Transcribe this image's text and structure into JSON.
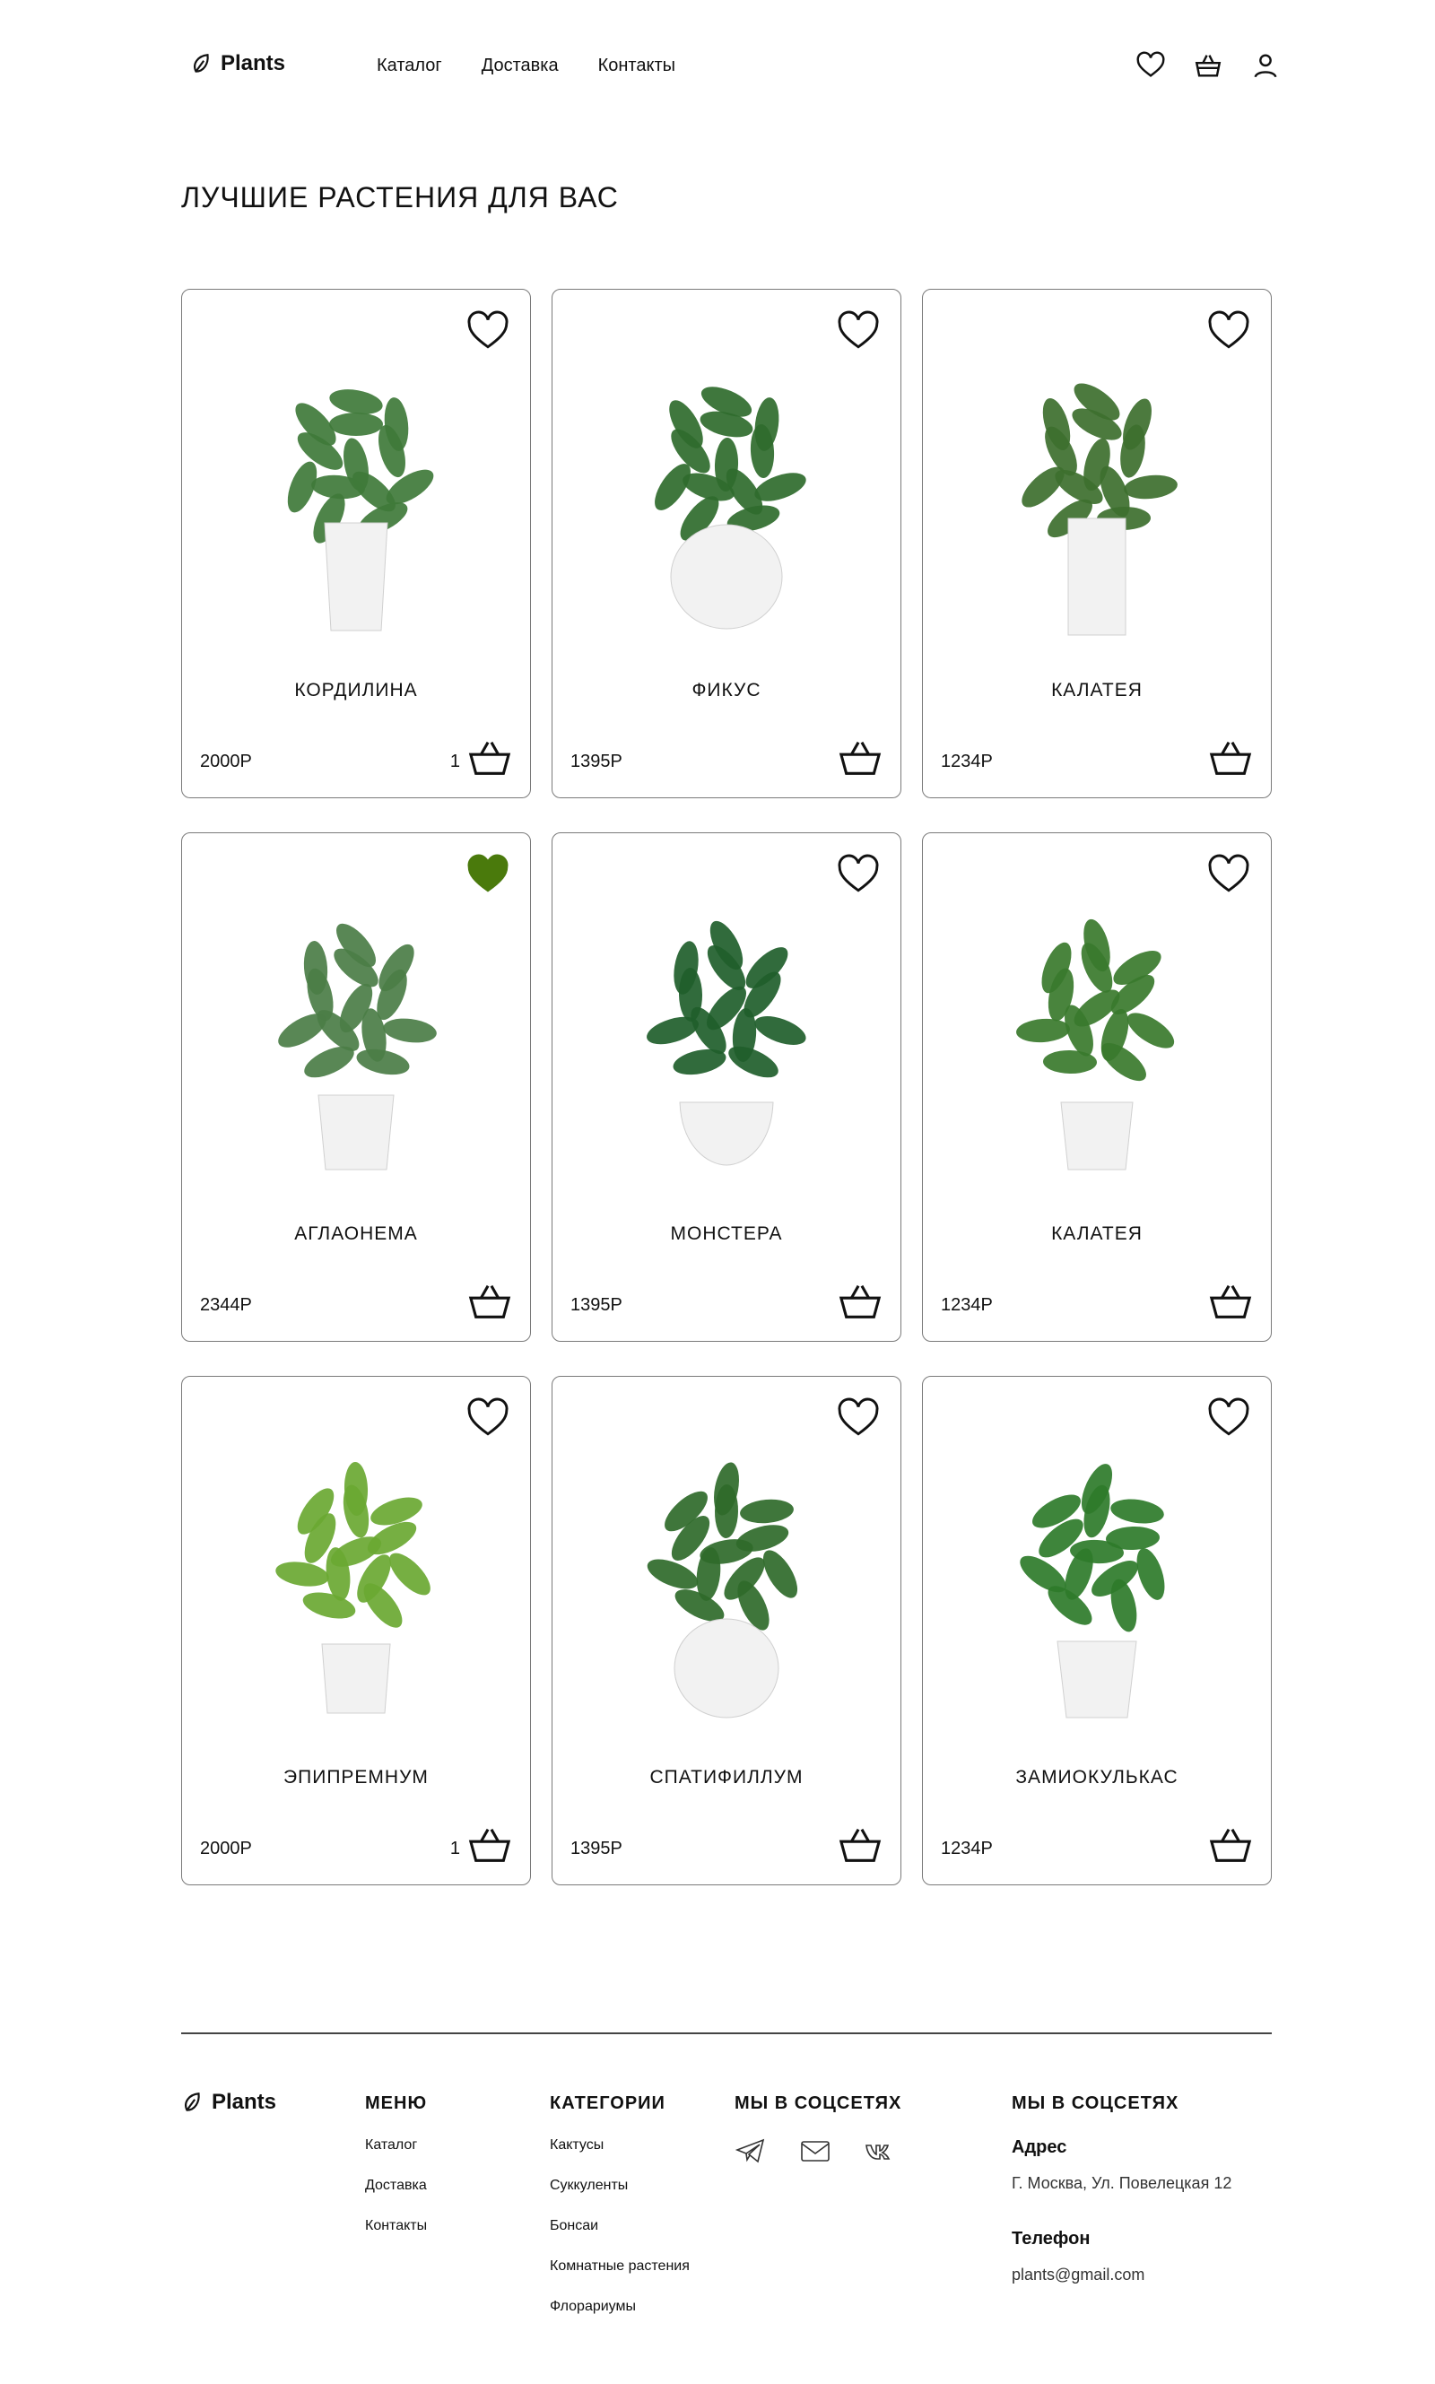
{
  "header": {
    "logo_text": "Plants",
    "nav": [
      "Каталог",
      "Доставка",
      "Контакты"
    ],
    "icons": [
      "heart-icon",
      "basket-icon",
      "user-icon"
    ]
  },
  "page_title": "ЛУЧШИЕ РАСТЕНИЯ ДЛЯ ВАС",
  "accent_color": "#4a7a0c",
  "products": [
    {
      "name": "КОРДИЛИНА",
      "price": "2000Р",
      "qty": "1",
      "favorite": false
    },
    {
      "name": "ФИКУС",
      "price": "1395Р",
      "qty": "",
      "favorite": false
    },
    {
      "name": "КАЛАТЕЯ",
      "price": "1234Р",
      "qty": "",
      "favorite": false
    },
    {
      "name": "АГЛАОНЕМА",
      "price": "2344Р",
      "qty": "",
      "favorite": true
    },
    {
      "name": "МОНСТЕРА",
      "price": "1395Р",
      "qty": "",
      "favorite": false
    },
    {
      "name": "КАЛАТЕЯ",
      "price": "1234Р",
      "qty": "",
      "favorite": false
    },
    {
      "name": "ЭПИПРЕМНУМ",
      "price": "2000Р",
      "qty": "1",
      "favorite": false
    },
    {
      "name": "СПАТИФИЛЛУМ",
      "price": "1395Р",
      "qty": "",
      "favorite": false
    },
    {
      "name": "ЗАМИОКУЛЬКАС",
      "price": "1234Р",
      "qty": "",
      "favorite": false
    }
  ],
  "footer": {
    "logo_text": "Plants",
    "menu": {
      "title": "МЕНЮ",
      "items": [
        "Каталог",
        "Доставка",
        "Контакты"
      ]
    },
    "categories": {
      "title": "КАТЕГОРИИ",
      "items": [
        "Кактусы",
        "Суккуленты",
        "Бонсаи",
        "Комнатные растения",
        "Флорариумы"
      ]
    },
    "social": {
      "title": "МЫ В СОЦСЕТЯХ",
      "icons": [
        "telegram-icon",
        "mail-icon",
        "vk-icon"
      ]
    },
    "contacts": {
      "title": "МЫ В СОЦСЕТЯХ",
      "address_label": "Адрес",
      "address": "Г. Москва, Ул. Повелецкая 12",
      "phone_label": "Телефон",
      "phone": "plants@gmail.com"
    }
  }
}
